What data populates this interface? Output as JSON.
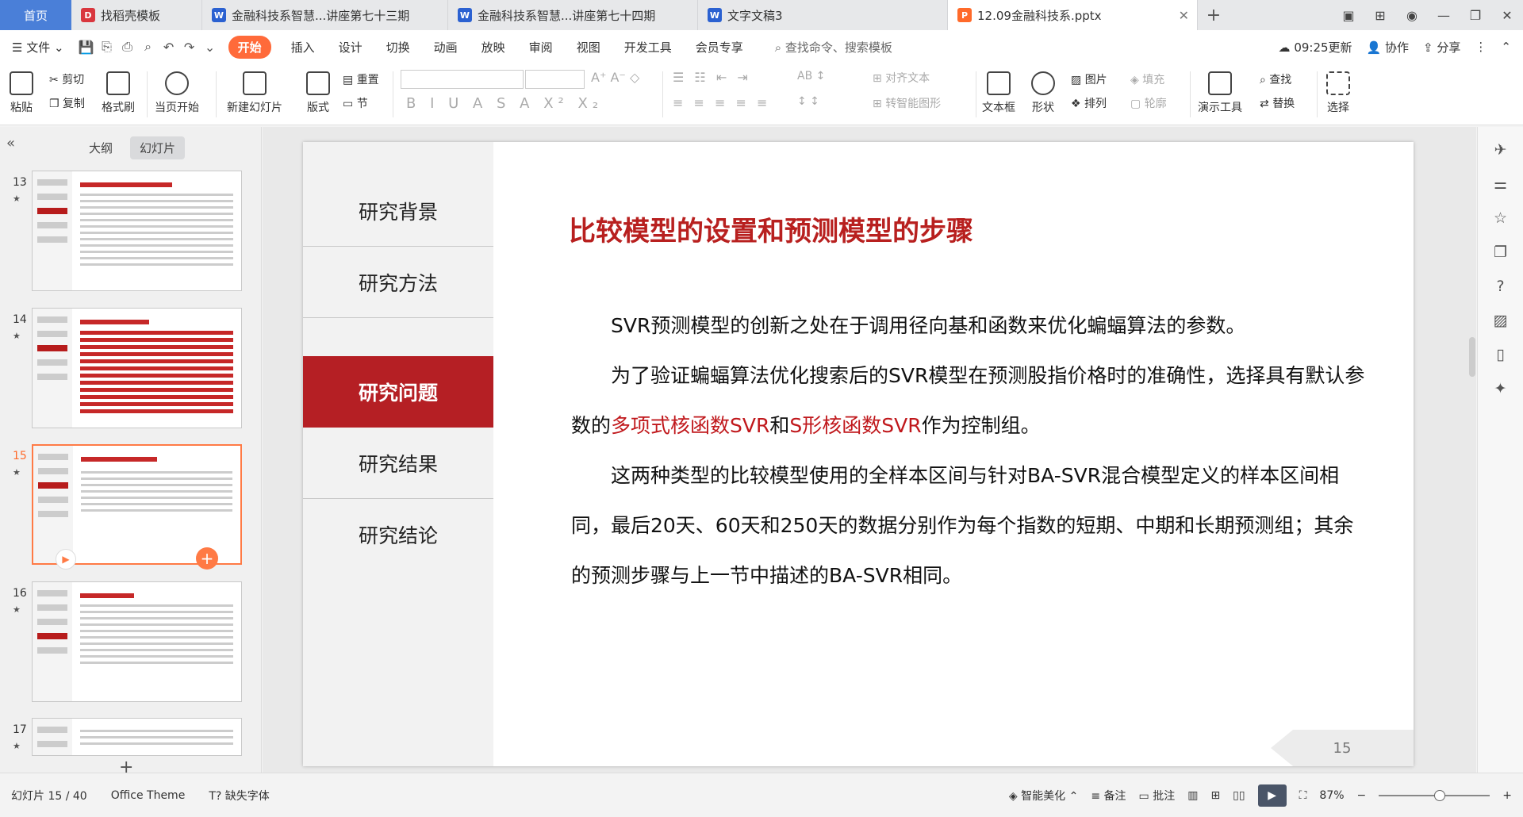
{
  "tabs": [
    {
      "label": "首页",
      "type": "home"
    },
    {
      "label": "找稻壳模板",
      "color": "#d9363e",
      "letter": "D"
    },
    {
      "label": "金融科技系智慧...讲座第七十三期",
      "color": "#2b61d1",
      "letter": "W"
    },
    {
      "label": "金融科技系智慧...讲座第七十四期",
      "color": "#2b61d1",
      "letter": "W"
    },
    {
      "label": "文字文稿3",
      "color": "#2b61d1",
      "letter": "W"
    },
    {
      "label": "12.09金融科技系.pptx",
      "color": "#ff6a2a",
      "letter": "P",
      "active": true
    }
  ],
  "menu": {
    "file": "文件",
    "start": "开始",
    "items": [
      "插入",
      "设计",
      "切换",
      "动画",
      "放映",
      "审阅",
      "视图",
      "开发工具",
      "会员专享"
    ],
    "search": "查找命令、搜索模板",
    "time": "09:25更新",
    "collab": "协作",
    "share": "分享"
  },
  "ribbon": {
    "paste": "粘贴",
    "cut": "剪切",
    "copy": "复制",
    "format": "格式刷",
    "play_from": "当页开始",
    "new_slide": "新建幻灯片",
    "layout": "版式",
    "reset": "重置",
    "section": "节",
    "align_text": "对齐文本",
    "smartart": "转智能图形",
    "textbox": "文本框",
    "shape": "形状",
    "picture": "图片",
    "fill": "填充",
    "arrange": "排列",
    "outline": "轮廓",
    "present": "演示工具",
    "find": "查找",
    "replace": "替换",
    "select": "选择"
  },
  "pane": {
    "outline": "大纲",
    "slides": "幻灯片"
  },
  "thumbs": [
    {
      "num": "13"
    },
    {
      "num": "14"
    },
    {
      "num": "15",
      "current": true
    },
    {
      "num": "16"
    },
    {
      "num": "17"
    }
  ],
  "slide": {
    "nav": [
      "研究背景",
      "研究方法",
      "研究问题",
      "研究结果",
      "研究结论"
    ],
    "active_index": 2,
    "title": "比较模型的设置和预测模型的步骤",
    "p1": "SVR预测模型的创新之处在于调用径向基和函数来优化蝙蝠算法的参数。",
    "p2a": "为了验证蝙蝠算法优化搜索后的SVR模型在预测股指价格时的准确性，选择具有默认参数的",
    "p2r1": "多项式核函数SVR",
    "p2b": "和",
    "p2r2": "S形核函数SVR",
    "p2c": "作为控制组。",
    "p3": "这两种类型的比较模型使用的全样本区间与针对BA-SVR混合模型定义的样本区间相同，最后20天、60天和250天的数据分别作为每个指数的短期、中期和长期预测组；其余的预测步骤与上一节中描述的BA-SVR相同。",
    "page": "15"
  },
  "status": {
    "slide_info": "幻灯片 15 / 40",
    "theme": "Office Theme",
    "missing_font": "缺失字体",
    "beautify": "智能美化",
    "notes": "备注",
    "comment": "批注",
    "zoom": "87%"
  },
  "colors": {
    "accent": "#ff6a3a",
    "title_red": "#b8201f",
    "nav_active": "#b51f24"
  }
}
